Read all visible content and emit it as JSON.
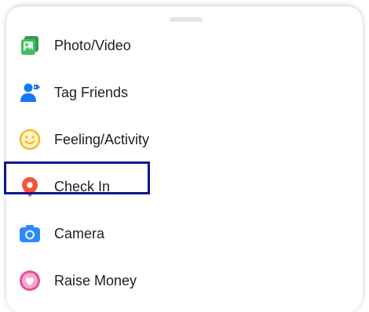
{
  "menu": {
    "items": [
      {
        "label": "Photo/Video",
        "icon": "photo-video-icon"
      },
      {
        "label": "Tag Friends",
        "icon": "tag-friends-icon"
      },
      {
        "label": "Feeling/Activity",
        "icon": "feeling-activity-icon"
      },
      {
        "label": "Check In",
        "icon": "check-in-icon"
      },
      {
        "label": "Camera",
        "icon": "camera-icon"
      },
      {
        "label": "Raise Money",
        "icon": "raise-money-icon"
      }
    ]
  },
  "colors": {
    "photo_green": "#45bd62",
    "tag_blue": "#1877f2",
    "feeling_yellow": "#f7b928",
    "checkin_red": "#f5533d",
    "camera_blue": "#2d88ff",
    "raise_pink": "#e64e9b",
    "highlight_border": "#0a1a8c"
  }
}
